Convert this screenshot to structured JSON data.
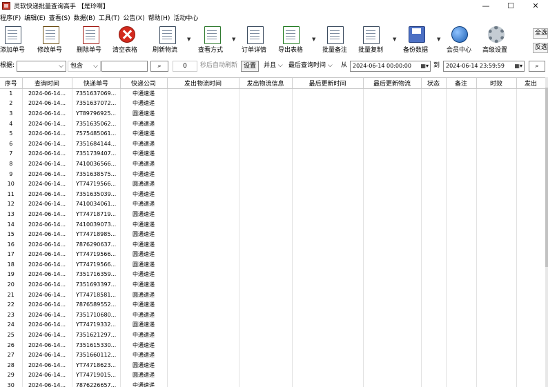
{
  "window": {
    "title": "灵软快递批量查询高手 【是玲啊】",
    "min": "—",
    "max": "☐",
    "close": "✕"
  },
  "menu": [
    "程序(F)",
    "编辑(E)",
    "查看(S)",
    "数据(B)",
    "工具(T)",
    "公告(X)",
    "帮助(H)",
    "活动中心"
  ],
  "toolbar": {
    "add": "添加单号",
    "edit": "修改单号",
    "delete": "删除单号",
    "clear": "清空表格",
    "refresh": "刷新物流",
    "view_mode": "查看方式",
    "order_detail": "订单详情",
    "export": "导出表格",
    "batch_note": "批量备注",
    "batch_copy": "批量复制",
    "backup": "备份数据",
    "member": "会员中心",
    "advanced": "高级设置",
    "select_all": "全选",
    "invert": "反选"
  },
  "filter": {
    "by_label": "根据:",
    "by_value": "",
    "match": "包含",
    "keyword": "",
    "seconds": "0",
    "auto_refresh_text": "秒后自动刷新",
    "set_button": "设置",
    "logic": "并且",
    "date_field": "最后查询时间",
    "from_label": "从",
    "from_value": "2024-06-14 00:00:00",
    "to_label": "到",
    "to_value": "2024-06-14 23:59:59"
  },
  "table": {
    "columns": [
      "序号",
      "查询时间",
      "快递单号",
      "快递公司",
      "发出物流时间",
      "发出物流信息",
      "最后更新时间",
      "最后更新物流",
      "状态",
      "备注",
      "时效",
      "发出"
    ],
    "rows": [
      [
        "1",
        "2024-06-14...",
        "7351637069...",
        "中通速递"
      ],
      [
        "2",
        "2024-06-14...",
        "7351637072...",
        "中通速递"
      ],
      [
        "3",
        "2024-06-14...",
        "YT89796925...",
        "圆通速递"
      ],
      [
        "4",
        "2024-06-14...",
        "7351635062...",
        "中通速递"
      ],
      [
        "5",
        "2024-06-14...",
        "7575485061...",
        "中通速递"
      ],
      [
        "6",
        "2024-06-14...",
        "7351684144...",
        "中通速递"
      ],
      [
        "7",
        "2024-06-14...",
        "7351739407...",
        "中通速递"
      ],
      [
        "8",
        "2024-06-14...",
        "7410036566...",
        "中通速递"
      ],
      [
        "9",
        "2024-06-14...",
        "7351638575...",
        "中通速递"
      ],
      [
        "10",
        "2024-06-14...",
        "YT74719566...",
        "圆通速递"
      ],
      [
        "11",
        "2024-06-14...",
        "7351635039...",
        "中通速递"
      ],
      [
        "12",
        "2024-06-14...",
        "7410034061...",
        "中通速递"
      ],
      [
        "13",
        "2024-06-14...",
        "YT74718719...",
        "圆通速递"
      ],
      [
        "14",
        "2024-06-14...",
        "7410039073...",
        "中通速递"
      ],
      [
        "15",
        "2024-06-14...",
        "YT74718985...",
        "圆通速递"
      ],
      [
        "16",
        "2024-06-14...",
        "7876290637...",
        "中通速递"
      ],
      [
        "17",
        "2024-06-14...",
        "YT74719566...",
        "圆通速递"
      ],
      [
        "18",
        "2024-06-14...",
        "YT74719566...",
        "圆通速递"
      ],
      [
        "19",
        "2024-06-14...",
        "7351716359...",
        "中通速递"
      ],
      [
        "20",
        "2024-06-14...",
        "7351693397...",
        "中通速递"
      ],
      [
        "21",
        "2024-06-14...",
        "YT74718581...",
        "圆通速递"
      ],
      [
        "22",
        "2024-06-14...",
        "7876589552...",
        "中通速递"
      ],
      [
        "23",
        "2024-06-14...",
        "7351710680...",
        "中通速递"
      ],
      [
        "24",
        "2024-06-14...",
        "YT74719332...",
        "圆通速递"
      ],
      [
        "25",
        "2024-06-14...",
        "7351621297...",
        "中通速递"
      ],
      [
        "26",
        "2024-06-14...",
        "7351615330...",
        "中通速递"
      ],
      [
        "27",
        "2024-06-14...",
        "7351660112...",
        "中通速递"
      ],
      [
        "28",
        "2024-06-14...",
        "YT74718623...",
        "圆通速递"
      ],
      [
        "29",
        "2024-06-14...",
        "YT74719015...",
        "圆通速递"
      ],
      [
        "30",
        "2024-06-14...",
        "7876226657...",
        "中通速递"
      ]
    ]
  }
}
